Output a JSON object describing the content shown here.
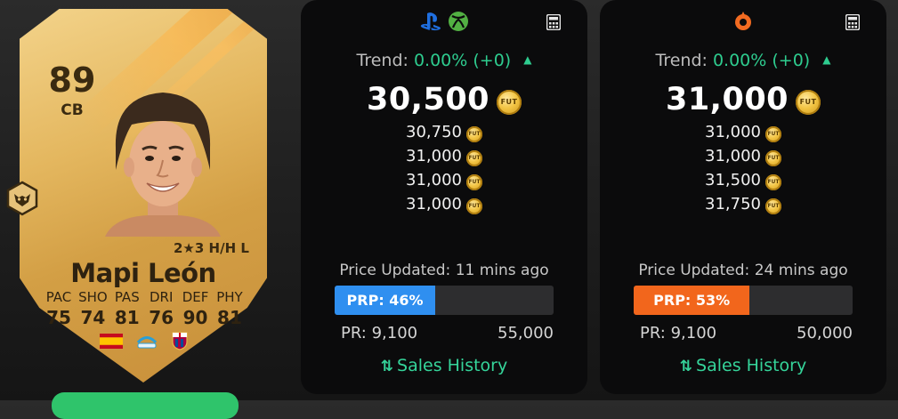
{
  "player": {
    "rating": "89",
    "position": "CB",
    "name": "Mapi León",
    "skills": "2★3 H/H L",
    "stat_labels": [
      "PAC",
      "SHO",
      "PAS",
      "DRI",
      "DEF",
      "PHY"
    ],
    "stat_values": [
      "75",
      "74",
      "81",
      "76",
      "90",
      "81"
    ],
    "flags": [
      "spain-flag-icon",
      "league-logo-icon",
      "club-crest-icon"
    ]
  },
  "panels": [
    {
      "platform_icons": [
        "playstation-icon",
        "xbox-icon"
      ],
      "trend_label": "Trend:",
      "trend_value": "0.00% (+0)",
      "main_price": "30,500",
      "coin_text": "FUT",
      "prices": [
        "30,750",
        "31,000",
        "31,000",
        "31,000"
      ],
      "updated": "Price Updated: 11 mins ago",
      "prp_label": "PRP: 46%",
      "prp_fraction": 0.46,
      "pr_min": "PR: 9,100",
      "pr_max": "55,000",
      "sales_label": "Sales History",
      "accent": "#2f8ff0"
    },
    {
      "platform_icons": [
        "origin-icon"
      ],
      "trend_label": "Trend:",
      "trend_value": "0.00% (+0)",
      "main_price": "31,000",
      "coin_text": "FUT",
      "prices": [
        "31,000",
        "31,000",
        "31,500",
        "31,750"
      ],
      "updated": "Price Updated: 24 mins ago",
      "prp_label": "PRP: 53%",
      "prp_fraction": 0.53,
      "pr_min": "PR: 9,100",
      "pr_max": "50,000",
      "sales_label": "Sales History",
      "accent": "#f2661c"
    }
  ],
  "colors": {
    "trend_green": "#2ecc8f",
    "sales_green": "#35d49a",
    "panel_bg": "#0b0b0c"
  }
}
